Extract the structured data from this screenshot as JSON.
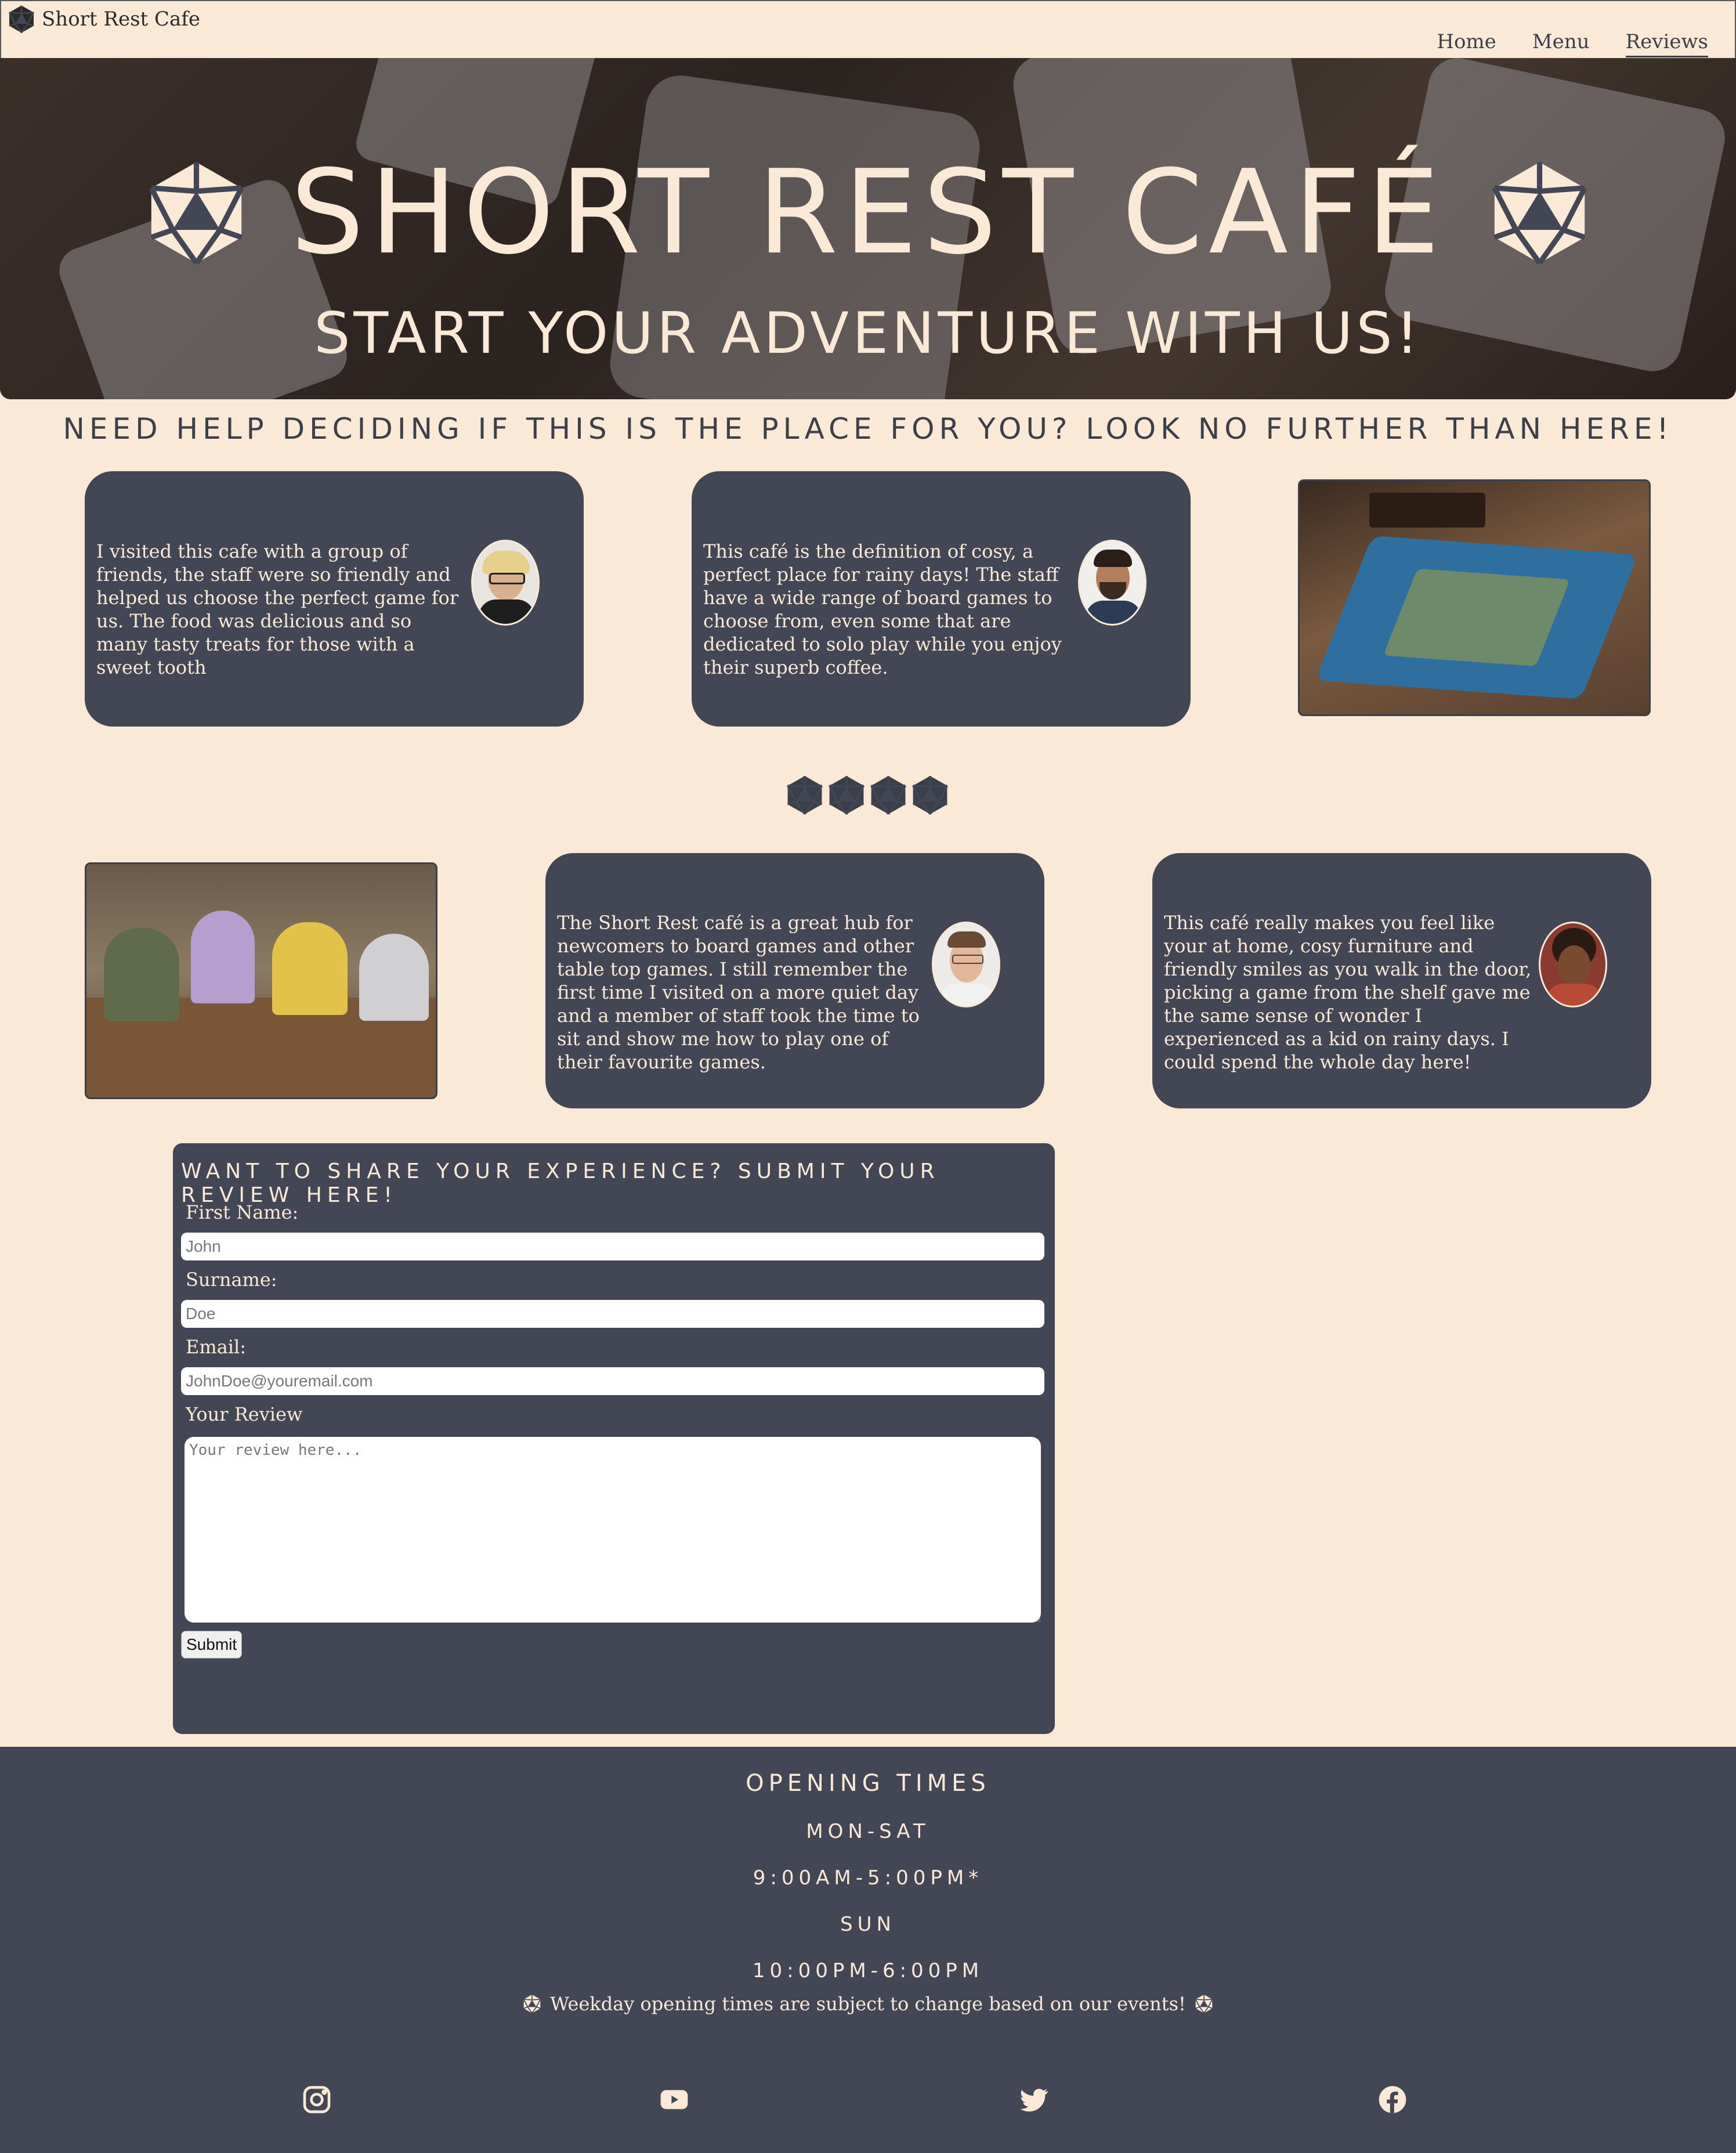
{
  "nav": {
    "brand": "Short Rest Cafe",
    "links": [
      "Home",
      "Menu",
      "Reviews"
    ],
    "active": "Reviews"
  },
  "hero": {
    "title": "SHORT REST CAFÉ",
    "subtitle": "START YOUR ADVENTURE WITH US!"
  },
  "intro": "NEED HELP DECIDING IF THIS IS THE PLACE FOR YOU? LOOK NO FURTHER THAN HERE!",
  "reviews": [
    {
      "text": "I visited this cafe with a group of friends, the staff were so friendly and helped us choose the perfect game for us. The food was delicious and so many tasty treats for those with a sweet tooth"
    },
    {
      "text": "This café is the definition of cosy, a perfect place for rainy days! The staff have a wide range of board games to choose from, even some that are dedicated to solo play while you enjoy their superb coffee."
    },
    {
      "text": "The Short Rest café is a great hub for newcomers to board games and other table top games. I still remember the first time I visited on a more quiet day and a member of staff took the time to sit and show me how to play one of their favourite games."
    },
    {
      "text": "This café really makes you feel like your at home, cosy furniture and friendly smiles as you walk in the door, picking a game from the shelf gave me the same sense of wonder I experienced as a kid on rainy days. I could spend the whole day here!"
    }
  ],
  "form": {
    "title": "WANT TO SHARE YOUR EXPERIENCE? SUBMIT YOUR REVIEW HERE!",
    "first_name_label": "First Name:",
    "first_name_placeholder": "John",
    "surname_label": "Surname:",
    "surname_placeholder": "Doe",
    "email_label": "Email:",
    "email_placeholder": "JohnDoe@youremail.com",
    "review_label": "Your Review",
    "review_placeholder": "Your review here...",
    "submit_label": "Submit"
  },
  "footer": {
    "heading": "OPENING TIMES",
    "days1": "MON-SAT",
    "hours1": "9:00AM-5:00PM*",
    "days2": "SUN",
    "hours2": "10:00PM-6:00PM",
    "note": "Weekday opening times are subject to change based on our events!",
    "socials": [
      "instagram-icon",
      "youtube-icon",
      "twitter-icon",
      "facebook-icon"
    ]
  },
  "colors": {
    "cream": "#f9e9d6",
    "slate": "#434654",
    "text_dark": "#3b3f4a"
  }
}
